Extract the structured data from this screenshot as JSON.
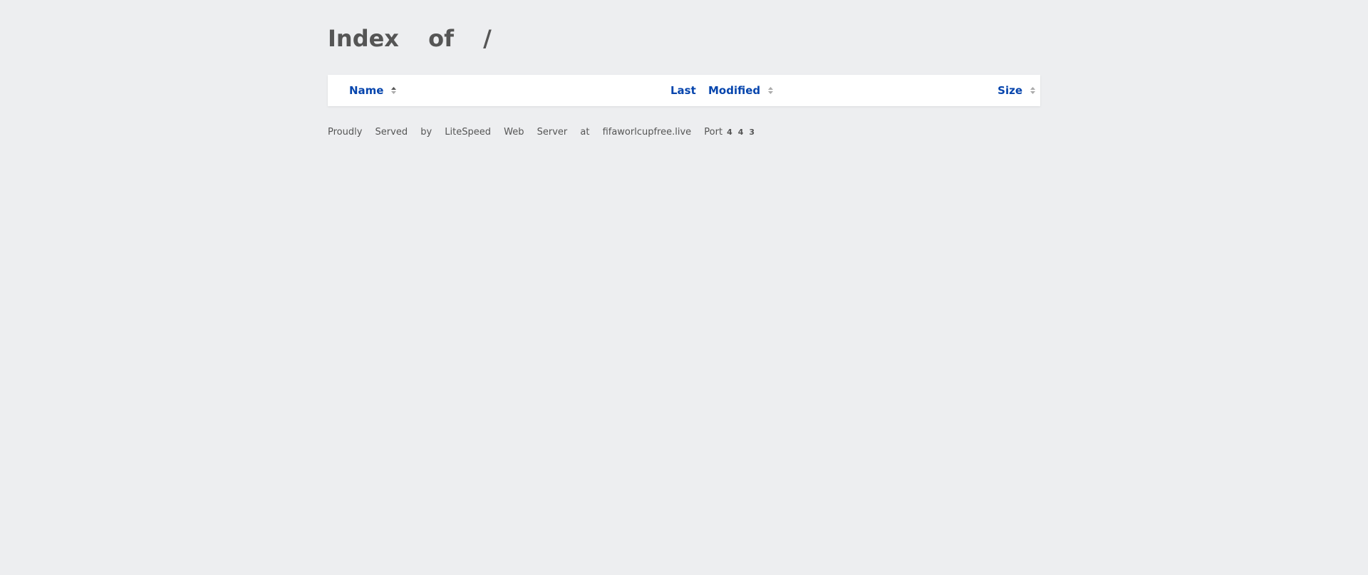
{
  "page": {
    "title": "Index of /"
  },
  "table": {
    "columns": [
      {
        "label": "Name",
        "icon": "sort-icon"
      },
      {
        "label": "Last Modified",
        "icon": "sort-icon"
      },
      {
        "label": "Size",
        "icon": "sort-icon"
      }
    ],
    "rows": []
  },
  "footer": {
    "text": "Proudly Served by LiteSpeed Web Server at fifaworlcupfree.live Port",
    "port": "443"
  },
  "colors": {
    "background": "#edeef0",
    "link": "#0645ad",
    "text": "#555555"
  }
}
